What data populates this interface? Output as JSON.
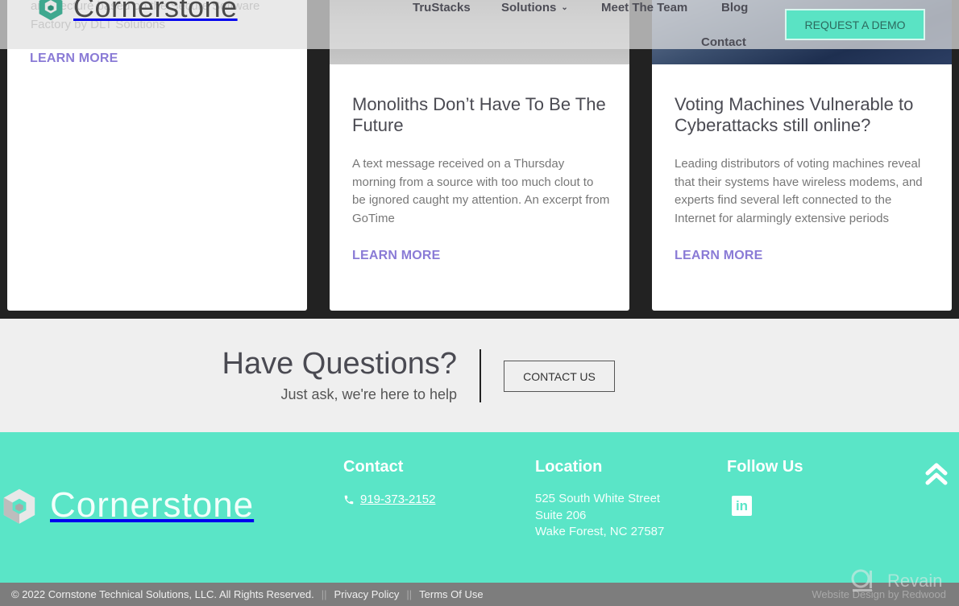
{
  "header": {
    "logo_text": "Cornerstone",
    "nav": [
      {
        "label": "TruStacks"
      },
      {
        "label": "Solutions",
        "has_dropdown": true
      },
      {
        "label": "Meet The Team"
      },
      {
        "label": "Blog"
      },
      {
        "label": "Contact"
      }
    ],
    "cta_label": "REQUEST A DEMO"
  },
  "cards": [
    {
      "excerpt_partial": "architecture based on the Secure Software Factory by DLT Solutions",
      "learn_more": "LEARN MORE"
    },
    {
      "title": "Monoliths Don’t Have To Be The Future",
      "excerpt": "A text message received on a Thursday morning from a source with too much clout to be ignored caught my attention. An excerpt from GoTime",
      "learn_more": "LEARN MORE"
    },
    {
      "title": "Voting Machines Vulnerable to Cyberattacks still online?",
      "excerpt": "Leading distributors of voting machines reveal that their systems have wireless modems, and experts find several left connected to the Internet for alarmingly extensive periods",
      "learn_more": "LEARN MORE"
    }
  ],
  "questions": {
    "title": "Have Questions?",
    "subtitle": "Just ask, we're here to help",
    "button": "CONTACT US"
  },
  "footer": {
    "logo_text": "Cornerstone",
    "contact_heading": "Contact",
    "phone": "919-373-2152",
    "location_heading": "Location",
    "address_line1": "525 South White Street",
    "address_line2": "Suite 206",
    "address_line3": "Wake Forest, NC 27587",
    "follow_heading": "Follow Us",
    "linkedin_label": "in"
  },
  "bottom_bar": {
    "copyright": "© 2022 Cornstone Technical Solutions, LLC. All Rights Reserved.",
    "separator": "||",
    "privacy": "Privacy Policy",
    "terms": "Terms Of Use",
    "credit": "Website Design by Redwood"
  },
  "watermark": {
    "label": "Revain"
  },
  "colors": {
    "accent": "#5ae5c7",
    "link": "#8a7bd6",
    "dark_bg": "#222222",
    "bottom_bar": "#7d7d7d"
  }
}
